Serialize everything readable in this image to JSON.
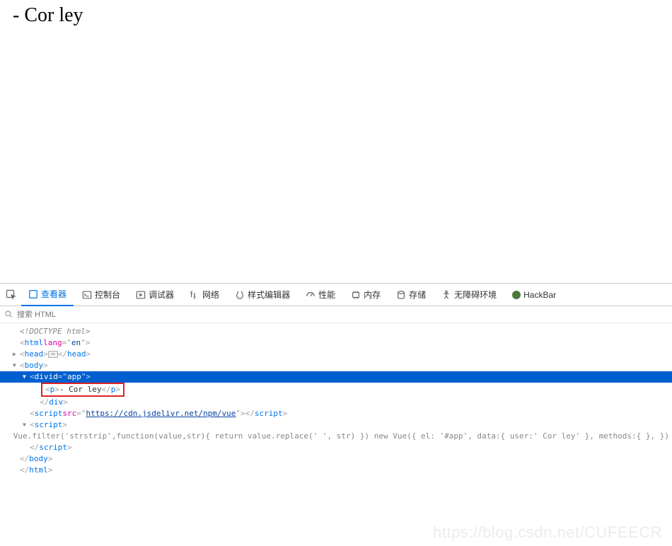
{
  "page": {
    "text": "- Cor ley"
  },
  "tabs": {
    "inspect": "查看器",
    "console": "控制台",
    "debugger": "调试器",
    "network": "网络",
    "style": "样式编辑器",
    "perf": "性能",
    "memory": "内存",
    "storage": "存储",
    "a11y": "无障碍环境",
    "hackbar": "HackBar"
  },
  "search": {
    "placeholder": "搜索 HTML"
  },
  "dom": {
    "doctype": "<!DOCTYPE html>",
    "html_lang": "en",
    "sel_attr": "id",
    "sel_val": "app",
    "p_text": "- Cor ley",
    "script_src": "https://cdn.jsdelivr.net/npm/vue",
    "script_body": "Vue.filter('strstrip',function(value,str){ return value.replace(' ', str) }) new Vue({ el: '#app', data:{ user:' Cor ley' }, methods:{ }, })"
  },
  "watermark": "https://blog.csdn.net/CUFEECR"
}
